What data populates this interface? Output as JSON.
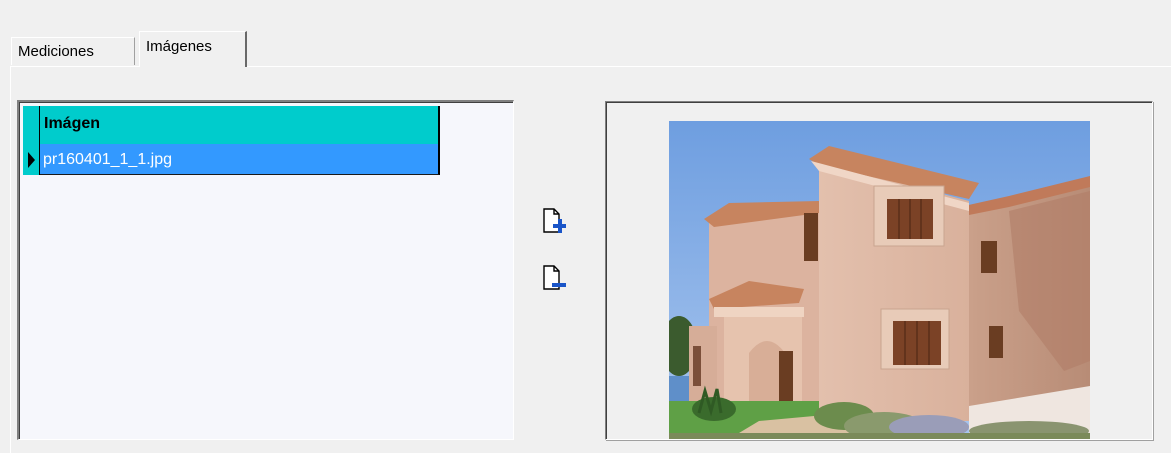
{
  "tabs": [
    {
      "label": "Mediciones",
      "active": false
    },
    {
      "label": "Imágenes",
      "active": true
    }
  ],
  "grid": {
    "column_header": "Imágen",
    "rows": [
      {
        "filename": "pr160401_1_1.jpg",
        "selected": true
      }
    ]
  },
  "actions": {
    "add_icon": "add-file-icon",
    "remove_icon": "remove-file-icon"
  },
  "preview": {
    "image_subject": "house-photo"
  },
  "colors": {
    "header_bg": "#00cccc",
    "selection_bg": "#3399ff",
    "window_bg": "#f0f0f0"
  }
}
